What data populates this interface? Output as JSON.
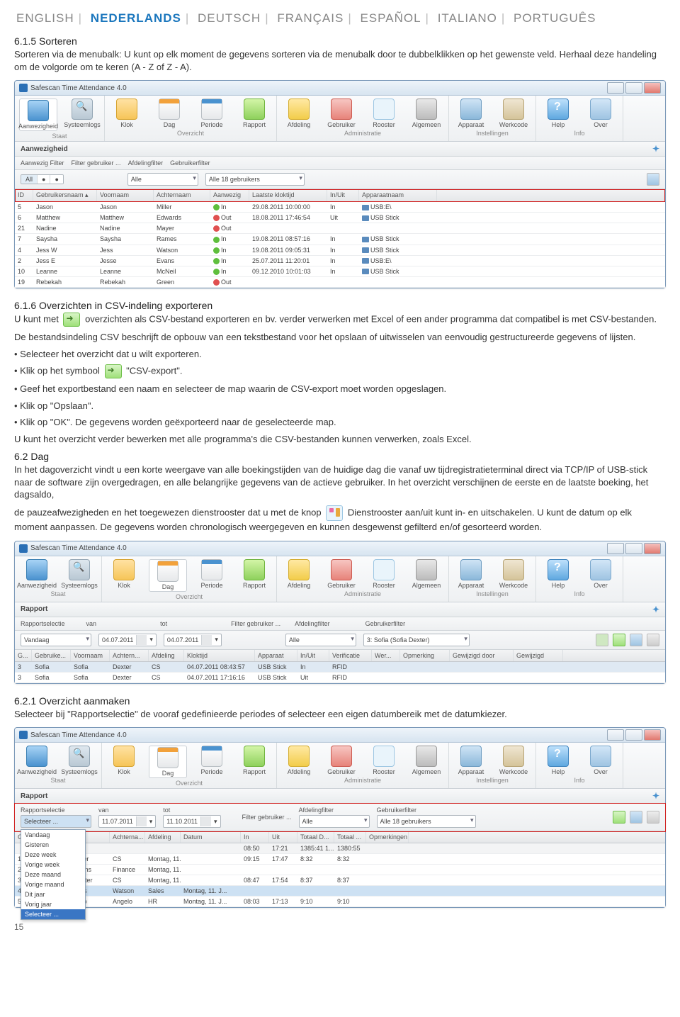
{
  "languages": {
    "items": [
      "ENGLISH",
      "NEDERLANDS",
      "DEUTSCH",
      "FRANÇAIS",
      "ESPAÑOL",
      "ITALIANO",
      "PORTUGUÊS"
    ],
    "active_index": 1
  },
  "s615": {
    "title": "6.1.5 Sorteren",
    "p1": "Sorteren via de menubalk: U kunt op elk moment de gegevens sorteren via de menubalk door te dubbelklikken op het gewenste veld. Herhaal deze handeling om de volgorde om te keren (A - Z of Z - A)."
  },
  "app": {
    "title": "Safescan Time Attendance 4.0",
    "ribbon": {
      "groups": [
        {
          "label": "Staat",
          "items": [
            {
              "label": "Aanwezigheid",
              "icon": "ic-monitor"
            },
            {
              "label": "Systeemlogs",
              "icon": "ic-search"
            }
          ]
        },
        {
          "label": "Overzicht",
          "items": [
            {
              "label": "Klok",
              "icon": "ic-clock"
            },
            {
              "label": "Dag",
              "icon": "ic-cal"
            },
            {
              "label": "Periode",
              "icon": "ic-period"
            },
            {
              "label": "Rapport",
              "icon": "ic-report"
            }
          ]
        },
        {
          "label": "Administratie",
          "items": [
            {
              "label": "Afdeling",
              "icon": "ic-key"
            },
            {
              "label": "Gebruiker",
              "icon": "ic-user"
            },
            {
              "label": "Rooster",
              "icon": "ic-roster"
            },
            {
              "label": "Algemeen",
              "icon": "ic-gear"
            }
          ]
        },
        {
          "label": "Instellingen",
          "items": [
            {
              "label": "Apparaat",
              "icon": "ic-device"
            },
            {
              "label": "Werkcode",
              "icon": "ic-code"
            }
          ]
        },
        {
          "label": "Info",
          "items": [
            {
              "label": "Help",
              "icon": "ic-help"
            },
            {
              "label": "Over",
              "icon": "ic-info"
            }
          ]
        }
      ]
    }
  },
  "att": {
    "panel_title": "Aanwezigheid",
    "filters": {
      "aanwezig_lbl": "Aanwezig Filter",
      "seg": [
        "All",
        "",
        ""
      ],
      "gebruiker_lbl": "Filter gebruiker ...",
      "afdeling_lbl": "Afdelingfilter",
      "afdeling_val": "Alle",
      "userfilter_lbl": "Gebruikerfilter",
      "userfilter_val": "Alle 18 gebruikers"
    },
    "headers": [
      "ID",
      "Gebruikersnaam   ▴",
      "Voornaam",
      "Achternaam",
      "Aanwezig",
      "Laatste kloktijd",
      "In/Uit",
      "Apparaatnaam"
    ],
    "rows": [
      {
        "id": "5",
        "user": "Jason",
        "first": "Jason",
        "last": "Miller",
        "pres": "in",
        "prestxt": "In",
        "time": "29.08.2011 10:00:00",
        "inout": "In",
        "dev": "USB:E\\"
      },
      {
        "id": "6",
        "user": "Matthew",
        "first": "Matthew",
        "last": "Edwards",
        "pres": "out",
        "prestxt": "Out",
        "time": "18.08.2011 17:46:54",
        "inout": "Uit",
        "dev": "USB Stick"
      },
      {
        "id": "21",
        "user": "Nadine",
        "first": "Nadine",
        "last": "Mayer",
        "pres": "out",
        "prestxt": "Out",
        "time": "",
        "inout": "",
        "dev": ""
      },
      {
        "id": "7",
        "user": "Saysha",
        "first": "Saysha",
        "last": "Rames",
        "pres": "in",
        "prestxt": "In",
        "time": "19.08.2011 08:57:16",
        "inout": "In",
        "dev": "USB Stick"
      },
      {
        "id": "4",
        "user": "Jess W",
        "first": "Jess",
        "last": "Watson",
        "pres": "in",
        "prestxt": "In",
        "time": "19.08.2011 09:05:31",
        "inout": "In",
        "dev": "USB Stick"
      },
      {
        "id": "2",
        "user": "Jess E",
        "first": "Jesse",
        "last": "Evans",
        "pres": "in",
        "prestxt": "In",
        "time": "25.07.2011 11:20:01",
        "inout": "In",
        "dev": "USB:E\\"
      },
      {
        "id": "10",
        "user": "Leanne",
        "first": "Leanne",
        "last": "McNeil",
        "pres": "in",
        "prestxt": "In",
        "time": "09.12.2010 10:01:03",
        "inout": "In",
        "dev": "USB Stick"
      },
      {
        "id": "19",
        "user": "Rebekah",
        "first": "Rebekah",
        "last": "Green",
        "pres": "out",
        "prestxt": "Out",
        "time": "",
        "inout": "",
        "dev": ""
      }
    ]
  },
  "s616": {
    "title": "6.1.6 Overzichten in CSV-indeling exporteren",
    "p1a": "U kunt met ",
    "p1b": " overzichten als CSV-bestand exporteren en bv. verder verwerken met Excel of een ander programma dat compatibel is met CSV-bestanden.",
    "p2": "De bestandsindeling CSV beschrijft de opbouw van een tekstbestand voor het opslaan of uitwisselen van eenvoudig gestructureerde gegevens of lijsten.",
    "b1": "• Selecteer het overzicht dat u wilt exporteren.",
    "b2a": "• Klik op het symbool ",
    "b2b": " \"CSV-export\".",
    "b3": "• Geef het exportbestand een naam en selecteer de map waarin de CSV-export moet worden opgeslagen.",
    "b4": "• Klik op \"Opslaan\".",
    "b5": "• Klik op \"OK\". De gegevens worden geëxporteerd naar de geselecteerde map.",
    "p3": "U kunt het overzicht verder bewerken met alle programma's die CSV-bestanden kunnen verwerken, zoals Excel."
  },
  "s62": {
    "title": "6.2 Dag",
    "p1": "In het dagoverzicht vindt u een korte weergave van alle boekingstijden van de huidige dag die vanaf uw tijdregistratieterminal direct via TCP/IP of USB-stick naar de software zijn overgedragen, en alle belangrijke gegevens van de actieve gebruiker. In het overzicht verschijnen de eerste en de laatste boeking, het dagsaldo,",
    "p2a": "de pauzeafwezigheden en het toegewezen dienstrooster dat u met de knop ",
    "p2b": " Dienstrooster aan/uit kunt in- en uitschakelen. U kunt de datum op elk moment aanpassen. De gegevens worden chronologisch weergegeven en kunnen desgewenst gefilterd en/of gesorteerd worden."
  },
  "rap": {
    "panel": "Rapport",
    "sel_lbl": "Rapportselectie",
    "sel_val": "Vandaag",
    "van_lbl": "van",
    "van_val": "04.07.2011",
    "tot_lbl": "tot",
    "tot_val": "04.07.2011",
    "fgeb": "Filter gebruiker ...",
    "afd_lbl": "Afdelingfilter",
    "afd_val": "Alle",
    "gfil_lbl": "Gebruikerfilter",
    "gfil_val": "3: Sofia (Sofia Dexter)",
    "headers": [
      "G...",
      "Gebruike...",
      "Voornaam",
      "Achtern...",
      "Afdeling",
      "Kloktijd",
      "Apparaat",
      "In/Uit",
      "Verificatie",
      "Wer...",
      "Opmerking",
      "Gewijzigd door",
      "Gewijzigd"
    ],
    "rows": [
      {
        "c": [
          "3",
          "Sofia",
          "Sofia",
          "Dexter",
          "CS",
          "04.07.2011 08:43:57",
          "USB Stick",
          "In",
          "RFID",
          "",
          "",
          "",
          ""
        ],
        "hl": true
      },
      {
        "c": [
          "3",
          "Sofia",
          "Sofia",
          "Dexter",
          "CS",
          "04.07.2011 17:16:16",
          "USB Stick",
          "Uit",
          "RFID",
          "",
          "",
          "",
          ""
        ]
      }
    ]
  },
  "s621": {
    "title": "6.2.1 Overzicht aanmaken",
    "p1": "Selecteer bij \"Rapportselectie\" de vooraf gedefinieerde periodes of selecteer een eigen datumbereik met de datumkiezer."
  },
  "sel": {
    "panel": "Rapport",
    "sel_lbl": "Rapportselectie",
    "sel_val": "Selecteer ...",
    "van_lbl": "van",
    "van_val": "11.07.2011",
    "tot_lbl": "tot",
    "tot_val": "11.10.2011",
    "afd_lbl": "Afdelingfilter",
    "afd_val": "Alle",
    "gfil_lbl": "Gebruikerfilter",
    "gfil_val": "Alle 18 gebruikers",
    "dropdown": [
      "Vandaag",
      "Gisteren",
      "Deze week",
      "Vorige week",
      "Deze maand",
      "Vorige maand",
      "Dit jaar",
      "Vorig jaar",
      "Selecteer ..."
    ],
    "headers": [
      "G...",
      "Gebruike...",
      "m",
      "Achterna...",
      "Afdeling",
      "Datum",
      "In",
      "Uit",
      "Totaal   D...",
      "Totaal ...",
      "Opmerkingen"
    ],
    "toprow": [
      "",
      "",
      "",
      "",
      "",
      "",
      "08:50",
      "17:21",
      "1385:41   1...",
      "1380:55",
      ""
    ],
    "rows": [
      {
        "c": [
          "1",
          "",
          "Miller",
          "CS",
          "Montag, 11. J...",
          "",
          "09:15",
          "17:47",
          "8:32",
          "8:32",
          ""
        ]
      },
      {
        "c": [
          "2",
          "",
          "Evans",
          "Finance",
          "Montag, 11. J...",
          "",
          "",
          "",
          "",
          "",
          ""
        ]
      },
      {
        "c": [
          "3",
          "",
          "Dexter",
          "CS",
          "Montag, 11. J...",
          "",
          "08:47",
          "17:54",
          "8:37",
          "8:37",
          ""
        ]
      },
      {
        "c": [
          "4",
          "Jess W",
          "Jess",
          "Watson",
          "Sales",
          "Montag, 11. J...",
          "",
          "",
          "",
          "",
          ""
        ],
        "hl": true
      },
      {
        "c": [
          "5",
          "Nino",
          "Nino",
          "Angelo",
          "HR",
          "Montag, 11. J...",
          "08:03",
          "17:13",
          "9:10",
          "9:10",
          ""
        ]
      }
    ]
  },
  "page": "15"
}
